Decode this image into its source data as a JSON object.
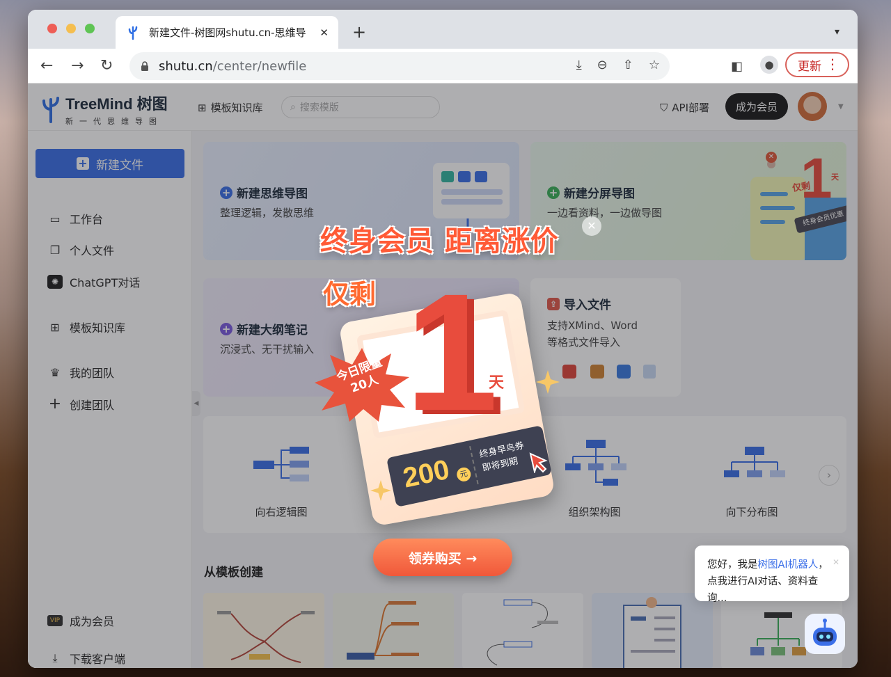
{
  "browser": {
    "tab_title": "新建文件-树图网shutu.cn-思维导",
    "tab_close": "✕",
    "new_tab": "+",
    "url_host": "shutu.cn",
    "url_path": "/center/newfile",
    "update_label": "更新"
  },
  "header": {
    "brand": "TreeMind 树图",
    "slogan": "新一代思维导图",
    "template_link": "模板知识库",
    "search_placeholder": "搜索模版",
    "api_link": "API部署",
    "member_button": "成为会员"
  },
  "sidebar": {
    "new_file": "新建文件",
    "items": [
      {
        "label": "工作台",
        "icon": "monitor-icon"
      },
      {
        "label": "个人文件",
        "icon": "folder-icon"
      },
      {
        "label": "ChatGPT对话",
        "icon": "chatgpt-icon"
      },
      {
        "label": "模板知识库",
        "icon": "grid-icon"
      },
      {
        "label": "我的团队",
        "icon": "team-icon"
      },
      {
        "label": "创建团队",
        "icon": "plus-icon"
      }
    ],
    "vip_badge": "VIP",
    "become_member": "成为会员",
    "download_client": "下载客户端"
  },
  "cards": {
    "mindmap": {
      "title": "新建思维导图",
      "desc": "整理逻辑，发散思维"
    },
    "split": {
      "title": "新建分屏导图",
      "desc": "一边看资料，一边做导图"
    },
    "outline": {
      "title": "新建大纲笔记",
      "desc": "沉浸式、无干扰输入"
    },
    "import": {
      "title": "导入文件",
      "desc1": "支持XMind、Word",
      "desc2": "等格式文件导入"
    }
  },
  "templates": {
    "items": [
      "向右逻辑图",
      "组织架构图",
      "向下分布图"
    ],
    "section_title": "从模板创建"
  },
  "bot": {
    "greeting_prefix": "您好，我是",
    "bot_name": "树图AI机器人",
    "greeting_suffix": "，",
    "line2": "点我进行AI对话、资料查询..."
  },
  "promo": {
    "headline": "终身会员 距离涨价",
    "remaining": "仅剩",
    "days_value": "1",
    "day_unit": "天",
    "limit_line1": "今日限量",
    "limit_line2": "20人",
    "coupon_amount": "200",
    "coupon_unit": "元",
    "coupon_line1": "终身早鸟券",
    "coupon_line2": "即将到期",
    "cta": "领券购买 →",
    "close": "✕",
    "mini_badge": "仅剩",
    "mini_ribbon": "终身会员优惠",
    "mini_day": "天"
  },
  "colors": {
    "accent_blue": "#3b6fe8",
    "promo_red": "#e84c3d",
    "promo_orange": "#ff5a36"
  }
}
